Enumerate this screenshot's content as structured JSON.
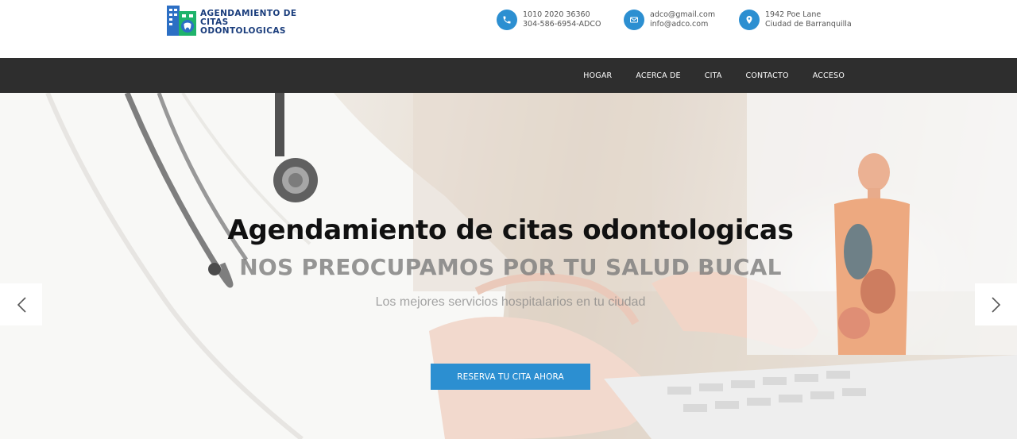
{
  "brand": {
    "name_line1": "AGENDAMIENTO DE",
    "name_line2": "CITAS",
    "name_line3": "ODONTOLOGICAS",
    "logo_icon": "hospital-tooth-icon"
  },
  "contacts": {
    "phone": {
      "icon": "phone-icon",
      "line1": "1010 2020 36360",
      "line2": "304-586-6954-ADCO"
    },
    "email": {
      "icon": "mail-icon",
      "line1": "adco@gmail.com",
      "line2": "info@adco.com"
    },
    "address": {
      "icon": "map-pin-icon",
      "line1": "1942 Poe Lane",
      "line2": "Ciudad de Barranquilla"
    }
  },
  "nav": {
    "items": [
      "HOGAR",
      "ACERCA DE",
      "CITA",
      "CONTACTO",
      "ACCESO"
    ]
  },
  "hero": {
    "title": "Agendamiento de citas odontologicas",
    "subtitle": "NOS PREOCUPAMOS POR TU SALUD BUCAL",
    "tagline": "Los mejores servicios hospitalarios en tu ciudad",
    "cta_label": "RESERVA TU CITA AHORA",
    "prev_icon": "chevron-left-icon",
    "next_icon": "chevron-right-icon"
  },
  "colors": {
    "accent": "#2c8fd1",
    "navbar": "#2e2e2e",
    "brand_text": "#1a3d7c",
    "logo_green": "#1fb36b"
  }
}
